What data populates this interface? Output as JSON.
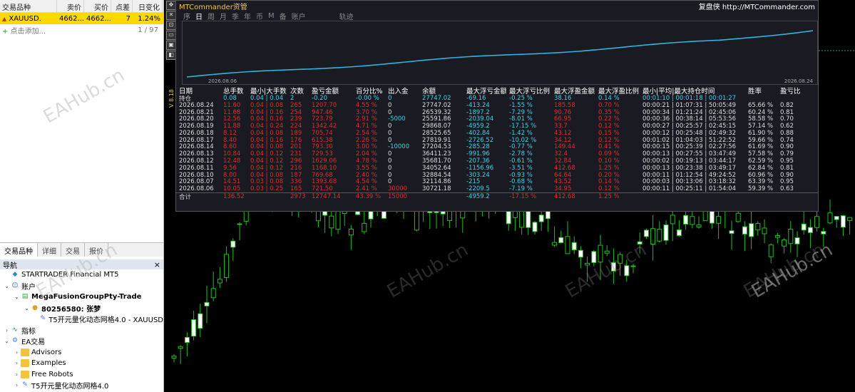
{
  "market_watch": {
    "headers": [
      "交易品种",
      "卖价",
      "买价",
      "点差",
      "日变化"
    ],
    "rows": [
      {
        "symbol": "XAUUSD.",
        "bid": "4662....",
        "ask": "4662....",
        "spread": "7",
        "change": "1.24%"
      }
    ],
    "add_label": "点击添加...",
    "count": "1 / 97"
  },
  "mw_tabs": [
    "交易品种",
    "详细",
    "交易",
    "报价"
  ],
  "navigator": {
    "title": "导航",
    "close": "×",
    "items": [
      {
        "text": "STARTRADER Financial MT5",
        "level": 0,
        "icon": "broker-icon"
      },
      {
        "text": "账户",
        "level": 0,
        "icon": "accounts-icon"
      },
      {
        "text": "MegaFusionGroupPty-Trade",
        "level": 1,
        "icon": "server-icon"
      },
      {
        "text": "80256580: 张梦",
        "level": 2,
        "icon": "user-icon"
      },
      {
        "text": "T5开元量化动态网格4.0 - XAUUSD",
        "level": 3,
        "icon": "ea-icon"
      },
      {
        "text": "指标",
        "level": 0,
        "icon": "indicators-icon"
      },
      {
        "text": "EA交易",
        "level": 0,
        "icon": "experts-icon"
      },
      {
        "text": "Advisors",
        "level": 1,
        "icon": "folder-icon"
      },
      {
        "text": "Examples",
        "level": 1,
        "icon": "folder-icon"
      },
      {
        "text": "Free Robots",
        "level": 1,
        "icon": "folder-icon"
      },
      {
        "text": "T5开元量化动态网格4.0",
        "level": 1,
        "icon": "ea-icon"
      }
    ]
  },
  "mtc": {
    "title": "MTCommander资管",
    "right": "复盘侠  http://MTCommander.com",
    "tabs": [
      "序",
      "日",
      "周",
      "月",
      "季",
      "年",
      "币",
      "M",
      "备",
      "账户",
      "轨迹"
    ],
    "active_tab": "日",
    "eq_start": "2026.08.06",
    "eq_end": "2026.08.24",
    "side_label": "V 8.18",
    "headers": [
      "日期",
      "总手数",
      "最小|大手数",
      "次数",
      "盈亏金额",
      "百分比%",
      "出入金",
      "余额",
      "最大浮亏金额",
      "最大浮亏比例",
      "最大浮盈金额",
      "最大浮盈比例",
      "最小|平均|最大持仓时间",
      "胜率",
      "盈亏比"
    ],
    "hold": [
      "持仓",
      "0.08",
      "0.04 | 0.04",
      "2",
      "-0.20",
      "-0.00 %",
      "0",
      "27747.02",
      "-69.16",
      "-0.25 %",
      "38.16",
      "0.14 %",
      "00:01:10 | 00:01:18 | 00:01:27",
      "",
      ""
    ],
    "rows": [
      [
        "2026.08.24",
        "11.60",
        "0.04 | 0.08",
        "265",
        "1207.70",
        "4.55 %",
        "0",
        "27747.02",
        "-413.24",
        "-1.55 %",
        "185.58",
        "0.70 %",
        "00:00:21 | 01:07:31 | 50:05:49",
        "65.66 %",
        "0.82"
      ],
      [
        "2026.08.21",
        "11.68",
        "0.04 | 0.16",
        "254",
        "947.46",
        "3.70 %",
        "0",
        "26539.32",
        "-1897.2",
        "-7.29 %",
        "90.76",
        "0.35 %",
        "00:00:34 | 01:21:24 | 02:45:06",
        "60.24 %",
        "0.81"
      ],
      [
        "2026.08.20",
        "12.56",
        "0.04 | 0.16",
        "239",
        "723.79",
        "2.91 %",
        "-5000",
        "25591.86",
        "-2039.04",
        "-8.01 %",
        "66.95",
        "0.22 %",
        "00:00:36 | 00:38:14 | 05:53:56",
        "58.58 %",
        "0.70"
      ],
      [
        "2026.08.19",
        "11.88",
        "0.04 | 0.24",
        "224",
        "1342.42",
        "4.71 %",
        "0",
        "29868.07",
        "-4959.2",
        "-17.15 %",
        "33.7",
        "0.12 %",
        "00:00:27 | 00:25:57 | 02:45:15",
        "57.14 %",
        "0.62"
      ],
      [
        "2026.08.18",
        "8.12",
        "0.04 | 0.08",
        "189",
        "705.74",
        "2.54 %",
        "0",
        "28525.65",
        "-402.84",
        "-1.42 %",
        "43.12",
        "0.15 %",
        "00:00:12 | 00:25:48 | 02:49:32",
        "61.90 %",
        "0.88"
      ],
      [
        "2026.08.17",
        "8.40",
        "0.04 | 0.16",
        "176",
        "615.38",
        "2.26 %",
        "0",
        "27819.91",
        "-2726.52",
        "-10.02 %",
        "34.12",
        "0.12 %",
        "00:01:02 | 01:04:03 | 51:22:52",
        "59.66 %",
        "0.74"
      ],
      [
        "2026.08.14",
        "8.60",
        "0.04 | 0.08",
        "201",
        "793.30",
        "3.00 %",
        "-10000",
        "27204.53",
        "-285.28",
        "-0.77 %",
        "149.44",
        "0.41 %",
        "00:00:15 | 00:25:39 | 02:27:56",
        "61.69 %",
        "0.90"
      ],
      [
        "2026.08.13",
        "10.84",
        "0.04 | 0.12",
        "231",
        "729.53",
        "2.04 %",
        "0",
        "36411.23",
        "-991.96",
        "-2.78 %",
        "32.4",
        "0.09 %",
        "00:00:13 | 00:27:55 | 03:47:49",
        "57.58 %",
        "0.79"
      ],
      [
        "2026.08.12",
        "12.48",
        "0.04 | 0.12",
        "296",
        "1629.06",
        "4.78 %",
        "0",
        "35681.70",
        "-207.36",
        "-0.61 %",
        "32.84",
        "0.10 %",
        "00:00:02 | 00:19:13 | 03:44:17",
        "62.59 %",
        "0.95"
      ],
      [
        "2026.08.11",
        "9.56",
        "0.04 | 0.12",
        "216",
        "1168.10",
        "3.55 %",
        "0",
        "34052.64",
        "-1156.96",
        "-3.51 %",
        "412.68",
        "1.25 %",
        "00:00:13 | 00:23:38 | 03:49:17",
        "62.84 %",
        "0.81"
      ],
      [
        "2026.08.10",
        "8.00",
        "0.04 | 0.08",
        "187",
        "769.68",
        "2.40 %",
        "0",
        "32884.54",
        "-303.24",
        "-0.93 %",
        "64.64",
        "0.20 %",
        "00:00:11 | 01:12:54 | 49:24:52",
        "60.96 %",
        "0.90"
      ],
      [
        "2026.08.07",
        "14.51",
        "0.03 | 0.08",
        "336",
        "1393.68",
        "4.54 %",
        "0",
        "32114.86",
        "-215",
        "-0.68 %",
        "43.52",
        "0.14 %",
        "00:00:03 | 00:13:06 | 03:18:32",
        "63.39 %",
        "0.95"
      ],
      [
        "2026.08.06",
        "10.05",
        "0.03 | 0.25",
        "165",
        "721.50",
        "2.41 %",
        "30000",
        "30721.18",
        "-2209.5",
        "-7.19 %",
        "34.95",
        "0.12 %",
        "00:00:11 | 00:25:11 | 01:54:04",
        "59.39 %",
        "0.63"
      ]
    ],
    "total": [
      "合计",
      "136.52",
      "",
      "2973",
      "12747.14",
      "43.39 %",
      "15000",
      "",
      "-4959.2",
      "-17.15 %",
      "412.68",
      "1.25 %",
      "",
      "",
      ""
    ]
  },
  "watermark": "EAHub.cn",
  "toolbar_icons": [
    "move-icon",
    "close-icon",
    "zoom-icon",
    "window-icon",
    "screenshot-icon",
    "history-icon"
  ]
}
